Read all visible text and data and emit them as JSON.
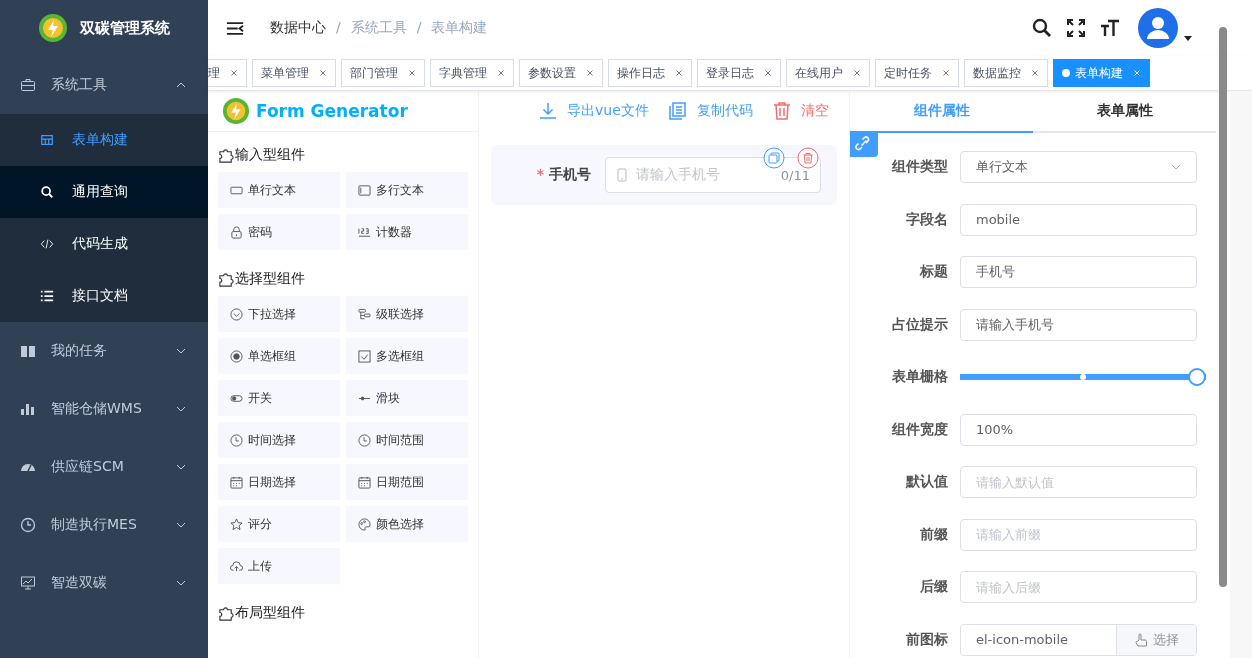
{
  "sidebar": {
    "title": "双碳管理系统",
    "items": [
      {
        "label": "系统工具",
        "expanded": true,
        "children": [
          {
            "label": "表单构建",
            "selected": true,
            "hovered": false
          },
          {
            "label": "通用查询",
            "selected": false,
            "hovered": true
          },
          {
            "label": "代码生成",
            "selected": false,
            "hovered": false
          },
          {
            "label": "接口文档",
            "selected": false,
            "hovered": false
          }
        ]
      },
      {
        "label": "我的任务",
        "expanded": false
      },
      {
        "label": "智能仓储WMS",
        "expanded": false
      },
      {
        "label": "供应链SCM",
        "expanded": false
      },
      {
        "label": "制造执行MES",
        "expanded": false
      },
      {
        "label": "智造双碳",
        "expanded": false
      }
    ]
  },
  "breadcrumb": {
    "separator": "/",
    "items": [
      "数据中心",
      "系统工具",
      "表单构建"
    ]
  },
  "tags": [
    {
      "label": "理",
      "selected": false
    },
    {
      "label": "菜单管理",
      "selected": false
    },
    {
      "label": "部门管理",
      "selected": false
    },
    {
      "label": "字典管理",
      "selected": false
    },
    {
      "label": "参数设置",
      "selected": false
    },
    {
      "label": "操作日志",
      "selected": false
    },
    {
      "label": "登录日志",
      "selected": false
    },
    {
      "label": "在线用户",
      "selected": false
    },
    {
      "label": "定时任务",
      "selected": false
    },
    {
      "label": "数据监控",
      "selected": false
    },
    {
      "label": "表单构建",
      "selected": true
    }
  ],
  "generator": {
    "title": "Form Generator",
    "groups": [
      {
        "title": "输入型组件",
        "items": [
          "单行文本",
          "多行文本",
          "密码",
          "计数器"
        ]
      },
      {
        "title": "选择型组件",
        "items": [
          "下拉选择",
          "级联选择",
          "单选框组",
          "多选框组",
          "开关",
          "滑块",
          "时间选择",
          "时间范围",
          "日期选择",
          "日期范围",
          "评分",
          "颜色选择",
          "上传"
        ]
      },
      {
        "title": "布局型组件"
      }
    ]
  },
  "toolbar": [
    {
      "label": "导出vue文件",
      "kind": "export"
    },
    {
      "label": "复制代码",
      "kind": "copy"
    },
    {
      "label": "清空",
      "kind": "clear"
    }
  ],
  "canvas": {
    "fields": [
      {
        "label": "手机号",
        "required_mark": "*",
        "placeholder": "请输入手机号",
        "counter": "0/11"
      }
    ]
  },
  "properties": {
    "tabs": [
      {
        "label": "组件属性",
        "selected": true
      },
      {
        "label": "表单属性",
        "selected": false
      }
    ],
    "rows": [
      {
        "label": "组件类型",
        "kind": "select",
        "value": "单行文本"
      },
      {
        "label": "字段名",
        "kind": "input",
        "value": "mobile"
      },
      {
        "label": "标题",
        "kind": "input",
        "value": "手机号"
      },
      {
        "label": "占位提示",
        "kind": "input",
        "value": "请输入手机号"
      },
      {
        "label": "表单栅格",
        "kind": "slider",
        "level": 1
      },
      {
        "label": "组件宽度",
        "kind": "input",
        "value": "100%"
      },
      {
        "label": "默认值",
        "kind": "input",
        "placeholder": "请输入默认值"
      },
      {
        "label": "前缀",
        "kind": "input",
        "placeholder": "请输入前缀"
      },
      {
        "label": "后缀",
        "kind": "input",
        "placeholder": "请输入后缀"
      },
      {
        "label": "前图标",
        "kind": "append",
        "value": "el-icon-mobile",
        "button": "选择"
      }
    ]
  }
}
